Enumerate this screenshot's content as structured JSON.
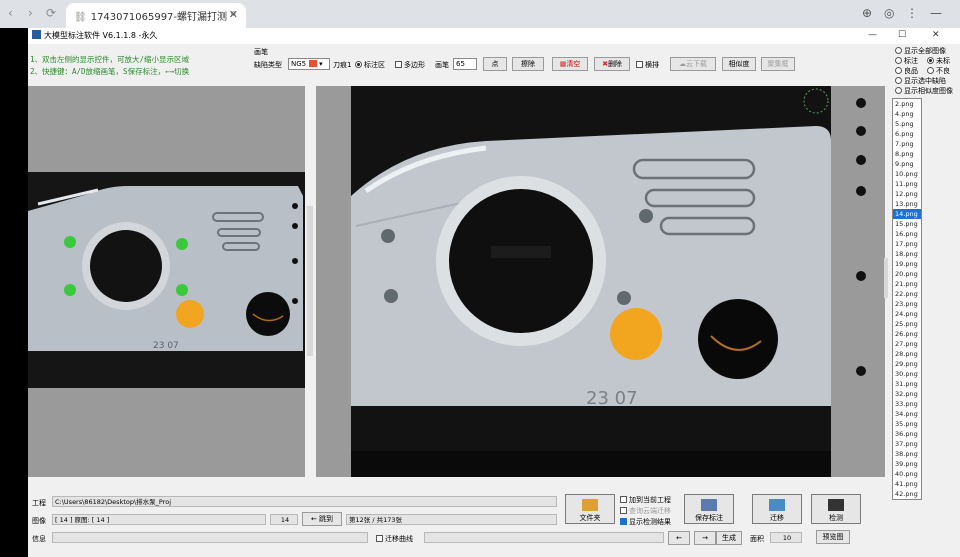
{
  "browser": {
    "tab_title": "1743071065997-螺钉漏打测",
    "back": "‹",
    "forward": "›",
    "reload": "⟳",
    "close": "✕",
    "search": "⌕",
    "menu": "⋮",
    "min": "—",
    "restore": "❐",
    "bclose": "✕"
  },
  "app": {
    "title": "大模型标注软件 V6.1.1.8 -永久",
    "win_min": "—",
    "win_max": "☐",
    "win_close": "✕",
    "hints": [
      "1、双击左侧的显示控件，可放大/缩小显示区域",
      "2、快捷键：A/D放缩画笔，S保存标注，←→切换"
    ],
    "toolbar": {
      "brush_group": "画笔",
      "defect_type_label": "缺陷类型",
      "defect_type_value": "NG5",
      "knife_label": "刀痕1",
      "mark_area": "标注区",
      "polygon": "多边形",
      "brush_label": "画笔",
      "brush_size": "65",
      "btn_dot": "点",
      "btn_erase": "擦除",
      "btn_clear": "清空",
      "btn_delete": "删除",
      "horizontal": "横排",
      "btn_cloud": "云下载",
      "btn_similar": "相似度",
      "btn_gather": "聚集框"
    },
    "filters": {
      "show_all": "显示全部图像",
      "marked": "标注",
      "unmarked": "未标",
      "good": "良品",
      "bad": "不良",
      "show_selected_defect": "显示选中缺陷",
      "show_similar": "显示相似度图像"
    },
    "files": [
      "2.png",
      "4.png",
      "5.png",
      "6.png",
      "7.png",
      "8.png",
      "9.png",
      "10.png",
      "11.png",
      "12.png",
      "13.png",
      "14.png",
      "15.png",
      "16.png",
      "17.png",
      "18.png",
      "19.png",
      "20.png",
      "21.png",
      "22.png",
      "23.png",
      "24.png",
      "25.png",
      "26.png",
      "27.png",
      "28.png",
      "29.png",
      "30.png",
      "31.png",
      "32.png",
      "33.png",
      "34.png",
      "35.png",
      "36.png",
      "37.png",
      "38.png",
      "39.png",
      "40.png",
      "41.png",
      "42.png"
    ],
    "selected_file": "14.png",
    "bottom": {
      "project_label": "工程",
      "project_path": "C:\\Users\\86182\\Desktop\\排水泵_Proj",
      "image_label": "图像",
      "image_value": "[ 14 ]  原图: [ 14 ]",
      "jump_value": "14",
      "jump_btn": "← 跳到",
      "count_text": "第12张 / 共173张",
      "info_label": "信息",
      "migrate_curve": "迁移曲线",
      "btn_folder": "文件夹",
      "add_current": "加到当前工程",
      "query_cloud": "查询云端迁移",
      "show_result": "显示检测结果",
      "btn_save": "保存标注",
      "btn_migrate": "迁移",
      "btn_detect": "检测",
      "btn_prev": "←",
      "btn_next": "→",
      "btn_generate": "生成",
      "area_label": "面积",
      "area_value": "10",
      "btn_preview": "预览图"
    }
  },
  "colors": {
    "defect": "#f2a51e",
    "marker": "#3cc83c"
  }
}
